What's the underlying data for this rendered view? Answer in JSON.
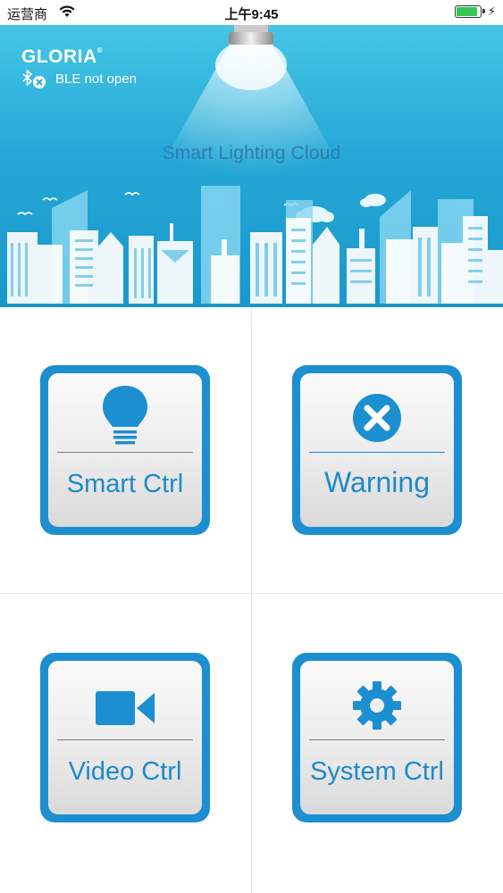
{
  "status_bar": {
    "carrier": "运营商",
    "time": "上午9:45",
    "battery_level": 0.9
  },
  "banner": {
    "brand": "GLORIA",
    "brand_mark": "®",
    "ble_status": "BLE not open",
    "slogan": "Smart Lighting Cloud"
  },
  "tiles": [
    {
      "label": "Smart Ctrl",
      "icon": "lightbulb-icon"
    },
    {
      "label": "Warning",
      "icon": "close-circle-icon"
    },
    {
      "label": "Video Ctrl",
      "icon": "video-camera-icon"
    },
    {
      "label": "System Ctrl",
      "icon": "gear-icon"
    }
  ],
  "colors": {
    "banner": "#25a8d6",
    "tile_frame": "#1b8fd0",
    "tile_text": "#1d8ac9"
  }
}
